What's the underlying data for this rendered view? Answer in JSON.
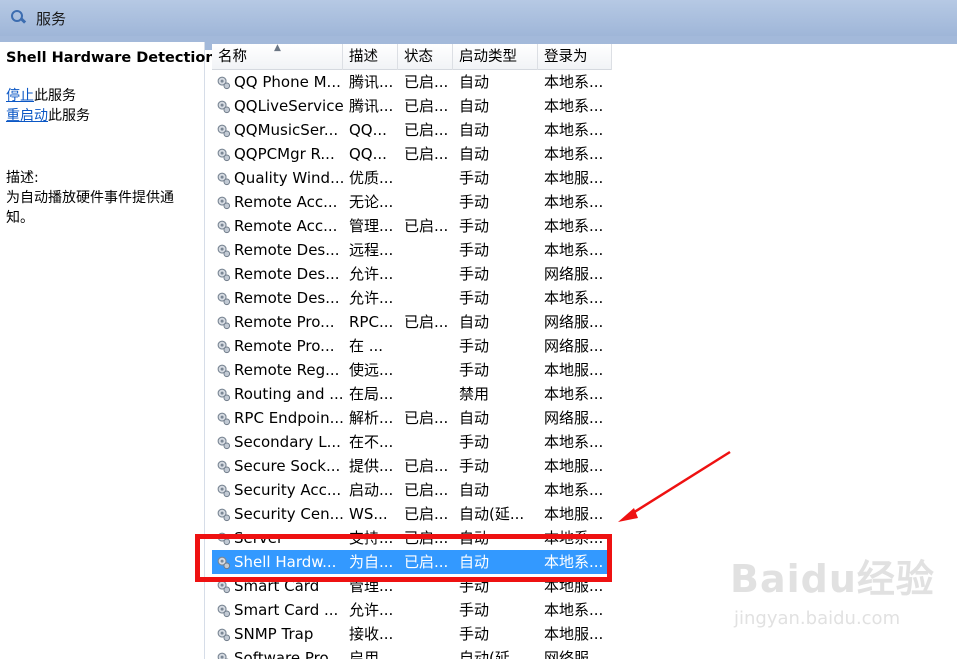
{
  "window": {
    "title": "服务"
  },
  "left_pane": {
    "service_name": "Shell Hardware Detection",
    "actions": [
      {
        "link": "停止",
        "suffix": "此服务"
      },
      {
        "link": "重启动",
        "suffix": "此服务"
      }
    ],
    "description_label": "描述:",
    "description": "为自动播放硬件事件提供通知。"
  },
  "columns": [
    "名称",
    "描述",
    "状态",
    "启动类型",
    "登录为"
  ],
  "rows": [
    {
      "name": "QQ Phone M...",
      "desc": "腾讯...",
      "status": "已启...",
      "startup": "自动",
      "logon": "本地系..."
    },
    {
      "name": "QQLiveService",
      "desc": "腾讯...",
      "status": "已启...",
      "startup": "自动",
      "logon": "本地系..."
    },
    {
      "name": "QQMusicSer...",
      "desc": "QQ...",
      "status": "已启...",
      "startup": "自动",
      "logon": "本地系..."
    },
    {
      "name": "QQPCMgr R...",
      "desc": "QQ...",
      "status": "已启...",
      "startup": "自动",
      "logon": "本地系..."
    },
    {
      "name": "Quality Wind...",
      "desc": "优质...",
      "status": "",
      "startup": "手动",
      "logon": "本地服..."
    },
    {
      "name": "Remote Acc...",
      "desc": "无论...",
      "status": "",
      "startup": "手动",
      "logon": "本地系..."
    },
    {
      "name": "Remote Acc...",
      "desc": "管理...",
      "status": "已启...",
      "startup": "手动",
      "logon": "本地系..."
    },
    {
      "name": "Remote Des...",
      "desc": "远程...",
      "status": "",
      "startup": "手动",
      "logon": "本地系..."
    },
    {
      "name": "Remote Des...",
      "desc": "允许...",
      "status": "",
      "startup": "手动",
      "logon": "网络服..."
    },
    {
      "name": "Remote Des...",
      "desc": "允许...",
      "status": "",
      "startup": "手动",
      "logon": "本地系..."
    },
    {
      "name": "Remote Pro...",
      "desc": "RPC...",
      "status": "已启...",
      "startup": "自动",
      "logon": "网络服..."
    },
    {
      "name": "Remote Pro...",
      "desc": "在 ...",
      "status": "",
      "startup": "手动",
      "logon": "网络服..."
    },
    {
      "name": "Remote Reg...",
      "desc": "使远...",
      "status": "",
      "startup": "手动",
      "logon": "本地服..."
    },
    {
      "name": "Routing and ...",
      "desc": "在局...",
      "status": "",
      "startup": "禁用",
      "logon": "本地系..."
    },
    {
      "name": "RPC Endpoin...",
      "desc": "解析...",
      "status": "已启...",
      "startup": "自动",
      "logon": "网络服..."
    },
    {
      "name": "Secondary L...",
      "desc": "在不...",
      "status": "",
      "startup": "手动",
      "logon": "本地系..."
    },
    {
      "name": "Secure Sock...",
      "desc": "提供...",
      "status": "已启...",
      "startup": "手动",
      "logon": "本地服..."
    },
    {
      "name": "Security Acc...",
      "desc": "启动...",
      "status": "已启...",
      "startup": "自动",
      "logon": "本地系..."
    },
    {
      "name": "Security Cen...",
      "desc": "WS...",
      "status": "已启...",
      "startup": "自动(延...",
      "logon": "本地服..."
    },
    {
      "name": "Server",
      "desc": "支持...",
      "status": "已启...",
      "startup": "自动",
      "logon": "本地系..."
    },
    {
      "name": "Shell Hardw...",
      "desc": "为自...",
      "status": "已启...",
      "startup": "自动",
      "logon": "本地系...",
      "selected": true
    },
    {
      "name": "Smart Card",
      "desc": "管理...",
      "status": "",
      "startup": "手动",
      "logon": "本地服..."
    },
    {
      "name": "Smart Card ...",
      "desc": "允许...",
      "status": "",
      "startup": "手动",
      "logon": "本地系..."
    },
    {
      "name": "SNMP Trap",
      "desc": "接收...",
      "status": "",
      "startup": "手动",
      "logon": "本地服..."
    },
    {
      "name": "Software Pro...",
      "desc": "启用...",
      "status": "",
      "startup": "自动(延...",
      "logon": "网络服..."
    }
  ],
  "watermark": {
    "main": "Baidu经验",
    "sub": "jingyan.baidu.com"
  },
  "colors": {
    "selection": "#3399ff",
    "highlight_box": "#ee1111",
    "link": "#0b57c5"
  }
}
